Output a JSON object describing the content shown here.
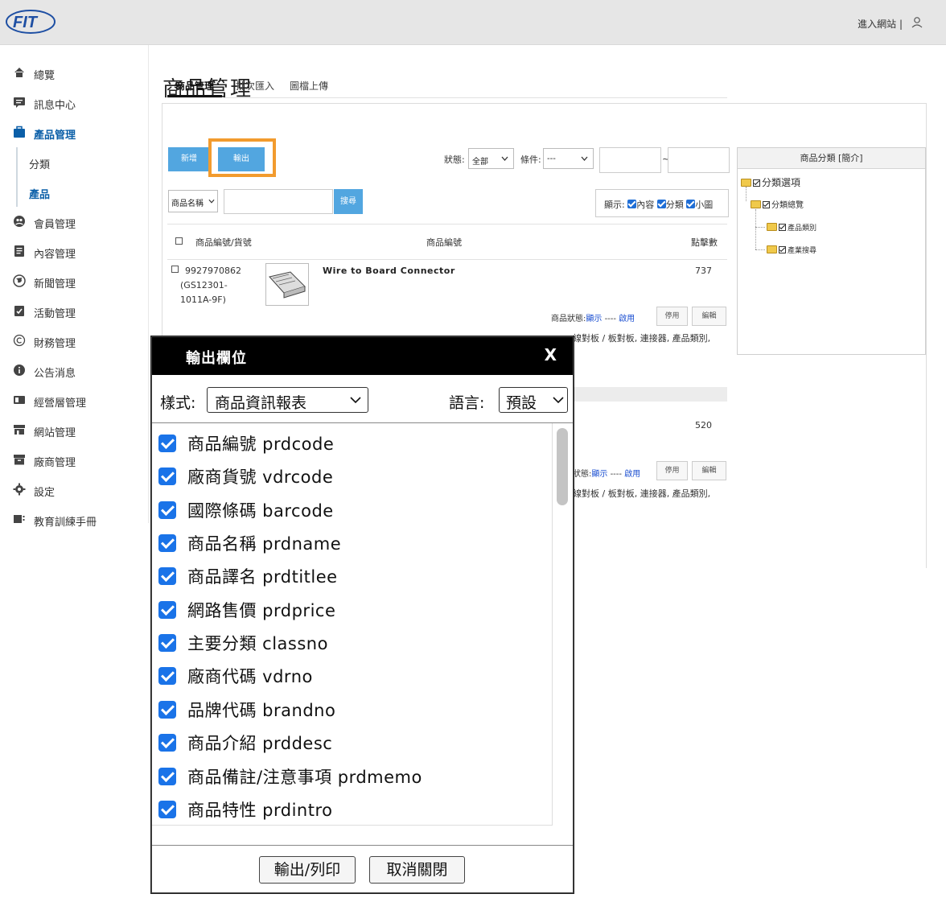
{
  "header": {
    "logo_text": "FIT",
    "enter_site": "進入網站 |"
  },
  "sidebar": {
    "items": [
      {
        "label": "總覽"
      },
      {
        "label": "訊息中心"
      },
      {
        "label": "產品管理"
      },
      {
        "label": "分類"
      },
      {
        "label": "產品"
      },
      {
        "label": "會員管理"
      },
      {
        "label": "內容管理"
      },
      {
        "label": "新聞管理"
      },
      {
        "label": "活動管理"
      },
      {
        "label": "財務管理"
      },
      {
        "label": "公告消息"
      },
      {
        "label": "經營層管理"
      },
      {
        "label": "網站管理"
      },
      {
        "label": "廠商管理"
      },
      {
        "label": "設定"
      },
      {
        "label": "教育訓練手冊"
      }
    ]
  },
  "main": {
    "title": "商品管理",
    "tabs": [
      {
        "label": "商品管理"
      },
      {
        "label": "批次匯入"
      },
      {
        "label": "圖檔上傳"
      }
    ],
    "toolbar": {
      "add_label": "新增",
      "export_label": "輸出",
      "status_label": "狀態:",
      "status_value": "全部",
      "condition_label": "條件:",
      "condition_value": "---",
      "tilde": "~",
      "search_field_value": "商品名稱",
      "search_label": "搜尋",
      "display_label": "顯示:",
      "display_options": [
        "內容",
        "分類",
        "小圖"
      ]
    },
    "table": {
      "headers": [
        "商品編號/貨號",
        "商品編號",
        "點擊數"
      ],
      "rows": [
        {
          "code_lines": [
            "9927970862",
            "(GS12301-",
            "1011A-9F)"
          ],
          "name": "Wire to Board Connector",
          "clicks": "737",
          "status_label": "商品狀態:",
          "status_show": "顯示",
          "status_sep": "----",
          "status_enable": "啟用",
          "disable_btn": "停用",
          "edit_btn": "編輯",
          "category_tail": "線對板 / 板對板, 連接器, 產品類別,"
        },
        {
          "clicks": "520",
          "status_label": "狀態:",
          "status_show": "顯示",
          "status_sep": "----",
          "status_enable": "啟用",
          "disable_btn": "停用",
          "edit_btn": "編輯",
          "category_tail": "線對板 / 板對板, 連接器, 產品類別,"
        }
      ]
    },
    "category_tree": {
      "title": "商品分類 [簡介]",
      "nodes": [
        "分類選項",
        "分類總覽",
        "產品類別",
        "產業搜尋"
      ]
    }
  },
  "modal": {
    "title": "輸出欄位",
    "close": "X",
    "style_label": "樣式:",
    "style_value": "商品資訊報表",
    "lang_label": "語言:",
    "lang_value": "預設",
    "fields": [
      "商品編號 prdcode",
      "廠商貨號 vdrcode",
      "國際條碼 barcode",
      "商品名稱 prdname",
      "商品譯名 prdtitlee",
      "網路售價 prdprice",
      "主要分類 classno",
      "廠商代碼 vdrno",
      "品牌代碼 brandno",
      "商品介紹 prddesc",
      "商品備註/注意事項 prdmemo",
      "商品特性 prdintro"
    ],
    "export_print_btn": "輸出/列印",
    "cancel_btn": "取消關閉"
  },
  "colors": {
    "accent_blue": "#52a6e0",
    "highlight_orange": "#f29b2e",
    "checkbox_blue": "#1a73e8",
    "active_nav": "#0b5fa8"
  }
}
